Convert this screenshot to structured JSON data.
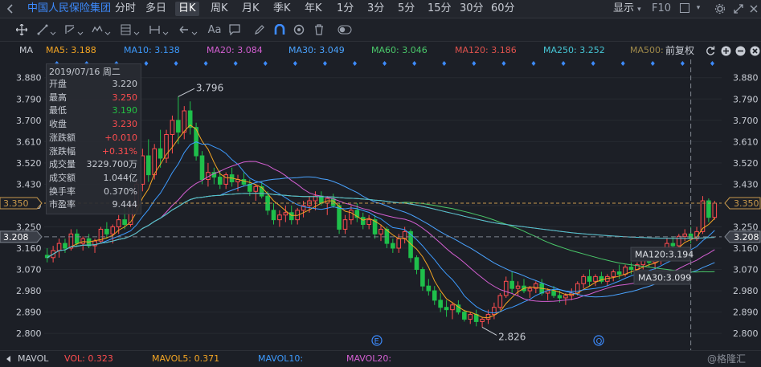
{
  "header": {
    "stock_name": "中国人民保险集团",
    "tabs": [
      "分时",
      "多日",
      "日K",
      "周K",
      "月K",
      "季K",
      "年K",
      "1分",
      "3分",
      "5分",
      "15分",
      "30分",
      "60分"
    ],
    "active_tab": "日K",
    "display_label": "显示",
    "f10_label": "F10"
  },
  "toolbar": {
    "font_label": "Aa"
  },
  "ma_bar": {
    "label": "MA",
    "items": [
      {
        "text": "MA5: 3.188",
        "color": "#f5a623"
      },
      {
        "text": "MA10: 3.138",
        "color": "#3d9bff"
      },
      {
        "text": "MA20: 3.084",
        "color": "#d45fd2"
      },
      {
        "text": "MA30: 3.049",
        "color": "#4aa3ff"
      },
      {
        "text": "MA60: 3.046",
        "color": "#4ac96a"
      },
      {
        "text": "MA120: 3.186",
        "color": "#e0524d"
      },
      {
        "text": "MA250: 3.252",
        "color": "#46c7d6"
      },
      {
        "text": "MA500:",
        "color": "#a08a4a"
      }
    ],
    "adjust_label": "前复权"
  },
  "info_panel": {
    "date": "2019/07/16 周二",
    "rows": [
      {
        "label": "开盘",
        "value": "3.220",
        "color": "#c8ccd4"
      },
      {
        "label": "最高",
        "value": "3.250",
        "color": "#ff4d4f"
      },
      {
        "label": "最低",
        "value": "3.190",
        "color": "#23c343"
      },
      {
        "label": "收盘",
        "value": "3.230",
        "color": "#ff4d4f"
      },
      {
        "label": "涨跌额",
        "value": "+0.010",
        "color": "#ff4d4f"
      },
      {
        "label": "涨跌幅",
        "value": "+0.31%",
        "color": "#ff4d4f"
      },
      {
        "label": "成交量",
        "value": "3229.700万",
        "color": "#c8ccd4"
      },
      {
        "label": "成交额",
        "value": "1.044亿",
        "color": "#c8ccd4"
      },
      {
        "label": "换手率",
        "value": "0.370%",
        "color": "#c8ccd4"
      },
      {
        "label": "市盈率",
        "value": "9.444",
        "color": "#c8ccd4"
      }
    ]
  },
  "axis": {
    "ticks": [
      "3.880",
      "3.790",
      "3.700",
      "3.610",
      "3.520",
      "3.430",
      "3.340",
      "3.250",
      "3.160",
      "3.070",
      "2.980",
      "2.890",
      "2.800"
    ],
    "current_price": "3.350",
    "cursor_price": "3.208"
  },
  "annotations": {
    "high": "3.796",
    "low": "2.826",
    "ma120_callout": "MA120:3.194",
    "ma30_callout": "MA30:3.099",
    "marker_e": "E",
    "marker_q": "Q"
  },
  "volume_bar": {
    "label": "MAVOL",
    "items": [
      {
        "text": "VOL: 0.323",
        "color": "#ff4d4f"
      },
      {
        "text": "MAVOL5: 0.371",
        "color": "#f5a623"
      },
      {
        "text": "MAVOL10:",
        "color": "#3d9bff"
      },
      {
        "text": "MAVOL20:",
        "color": "#d45fd2"
      }
    ],
    "watermark": "@格隆汇"
  },
  "chart_data": {
    "type": "candlestick",
    "ylim": [
      2.77,
      3.93
    ],
    "candles": [
      [
        3.13,
        3.16,
        3.1,
        3.12
      ],
      [
        3.12,
        3.17,
        3.1,
        3.15
      ],
      [
        3.15,
        3.2,
        3.12,
        3.18
      ],
      [
        3.18,
        3.2,
        3.14,
        3.16
      ],
      [
        3.16,
        3.24,
        3.15,
        3.22
      ],
      [
        3.22,
        3.24,
        3.17,
        3.18
      ],
      [
        3.18,
        3.21,
        3.15,
        3.2
      ],
      [
        3.2,
        3.22,
        3.16,
        3.17
      ],
      [
        3.17,
        3.2,
        3.14,
        3.19
      ],
      [
        3.19,
        3.25,
        3.18,
        3.24
      ],
      [
        3.24,
        3.27,
        3.2,
        3.22
      ],
      [
        3.22,
        3.26,
        3.18,
        3.25
      ],
      [
        3.25,
        3.3,
        3.22,
        3.28
      ],
      [
        3.28,
        3.33,
        3.24,
        3.26
      ],
      [
        3.26,
        3.36,
        3.25,
        3.34
      ],
      [
        3.34,
        3.45,
        3.32,
        3.43
      ],
      [
        3.43,
        3.58,
        3.4,
        3.55
      ],
      [
        3.55,
        3.62,
        3.44,
        3.47
      ],
      [
        3.47,
        3.6,
        3.45,
        3.58
      ],
      [
        3.58,
        3.66,
        3.5,
        3.54
      ],
      [
        3.54,
        3.66,
        3.52,
        3.64
      ],
      [
        3.64,
        3.72,
        3.56,
        3.7
      ],
      [
        3.7,
        3.8,
        3.6,
        3.65
      ],
      [
        3.65,
        3.76,
        3.62,
        3.74
      ],
      [
        3.74,
        3.78,
        3.64,
        3.67
      ],
      [
        3.67,
        3.69,
        3.53,
        3.55
      ],
      [
        3.55,
        3.57,
        3.43,
        3.45
      ],
      [
        3.45,
        3.52,
        3.42,
        3.48
      ],
      [
        3.48,
        3.5,
        3.43,
        3.46
      ],
      [
        3.46,
        3.49,
        3.41,
        3.43
      ],
      [
        3.43,
        3.48,
        3.41,
        3.47
      ],
      [
        3.47,
        3.5,
        3.42,
        3.44
      ],
      [
        3.44,
        3.47,
        3.4,
        3.45
      ],
      [
        3.45,
        3.48,
        3.42,
        3.43
      ],
      [
        3.43,
        3.45,
        3.38,
        3.4
      ],
      [
        3.4,
        3.43,
        3.36,
        3.42
      ],
      [
        3.42,
        3.44,
        3.37,
        3.38
      ],
      [
        3.38,
        3.4,
        3.3,
        3.32
      ],
      [
        3.32,
        3.35,
        3.26,
        3.28
      ],
      [
        3.28,
        3.32,
        3.25,
        3.3
      ],
      [
        3.3,
        3.34,
        3.27,
        3.31
      ],
      [
        3.31,
        3.34,
        3.26,
        3.28
      ],
      [
        3.28,
        3.33,
        3.26,
        3.32
      ],
      [
        3.32,
        3.36,
        3.29,
        3.34
      ],
      [
        3.34,
        3.38,
        3.31,
        3.36
      ],
      [
        3.36,
        3.4,
        3.32,
        3.38
      ],
      [
        3.38,
        3.4,
        3.34,
        3.35
      ],
      [
        3.35,
        3.38,
        3.3,
        3.37
      ],
      [
        3.37,
        3.39,
        3.33,
        3.34
      ],
      [
        3.34,
        3.35,
        3.22,
        3.24
      ],
      [
        3.24,
        3.3,
        3.22,
        3.28
      ],
      [
        3.28,
        3.34,
        3.26,
        3.32
      ],
      [
        3.32,
        3.35,
        3.27,
        3.29
      ],
      [
        3.29,
        3.31,
        3.24,
        3.26
      ],
      [
        3.26,
        3.3,
        3.24,
        3.28
      ],
      [
        3.28,
        3.3,
        3.2,
        3.22
      ],
      [
        3.22,
        3.26,
        3.19,
        3.24
      ],
      [
        3.24,
        3.25,
        3.16,
        3.18
      ],
      [
        3.18,
        3.2,
        3.14,
        3.16
      ],
      [
        3.16,
        3.22,
        3.14,
        3.2
      ],
      [
        3.2,
        3.25,
        3.18,
        3.23
      ],
      [
        3.23,
        3.24,
        3.1,
        3.12
      ],
      [
        3.12,
        3.13,
        3.05,
        3.07
      ],
      [
        3.07,
        3.08,
        2.98,
        3.0
      ],
      [
        3.0,
        3.03,
        2.96,
        2.98
      ],
      [
        2.98,
        3.0,
        2.92,
        2.94
      ],
      [
        2.94,
        2.97,
        2.89,
        2.91
      ],
      [
        2.91,
        2.94,
        2.87,
        2.9
      ],
      [
        2.9,
        2.93,
        2.86,
        2.92
      ],
      [
        2.92,
        2.94,
        2.88,
        2.89
      ],
      [
        2.89,
        2.9,
        2.85,
        2.86
      ],
      [
        2.86,
        2.89,
        2.84,
        2.88
      ],
      [
        2.88,
        2.9,
        2.83,
        2.85
      ],
      [
        2.85,
        2.87,
        2.826,
        2.86
      ],
      [
        2.86,
        2.9,
        2.84,
        2.88
      ],
      [
        2.88,
        2.93,
        2.86,
        2.91
      ],
      [
        2.91,
        2.97,
        2.9,
        2.96
      ],
      [
        2.96,
        3.04,
        2.95,
        3.02
      ],
      [
        3.02,
        3.06,
        2.97,
        2.99
      ],
      [
        2.99,
        3.02,
        2.96,
        3.0
      ],
      [
        3.0,
        3.03,
        2.97,
        2.98
      ],
      [
        2.98,
        3.0,
        2.95,
        2.99
      ],
      [
        2.99,
        3.02,
        2.97,
        3.01
      ],
      [
        3.01,
        3.03,
        2.96,
        2.97
      ],
      [
        2.97,
        2.99,
        2.94,
        2.98
      ],
      [
        2.98,
        3.0,
        2.95,
        2.96
      ],
      [
        2.96,
        2.98,
        2.93,
        2.95
      ],
      [
        2.95,
        2.97,
        2.92,
        2.96
      ],
      [
        2.96,
        2.99,
        2.94,
        2.97
      ],
      [
        2.97,
        3.02,
        2.96,
        3.01
      ],
      [
        3.01,
        3.05,
        2.99,
        3.04
      ],
      [
        3.04,
        3.07,
        3.0,
        3.02
      ],
      [
        3.02,
        3.05,
        3.0,
        3.04
      ],
      [
        3.04,
        3.06,
        3.01,
        3.02
      ],
      [
        3.02,
        3.05,
        3.0,
        3.04
      ],
      [
        3.04,
        3.07,
        3.02,
        3.06
      ],
      [
        3.06,
        3.09,
        3.03,
        3.05
      ],
      [
        3.05,
        3.09,
        3.04,
        3.08
      ],
      [
        3.08,
        3.1,
        3.05,
        3.07
      ],
      [
        3.07,
        3.1,
        3.05,
        3.09
      ],
      [
        3.09,
        3.13,
        3.07,
        3.11
      ],
      [
        3.11,
        3.13,
        3.08,
        3.1
      ],
      [
        3.1,
        3.12,
        3.07,
        3.11
      ],
      [
        3.11,
        3.15,
        3.09,
        3.14
      ],
      [
        3.14,
        3.2,
        3.13,
        3.18
      ],
      [
        3.18,
        3.21,
        3.15,
        3.17
      ],
      [
        3.17,
        3.22,
        3.16,
        3.21
      ],
      [
        3.21,
        3.24,
        3.19,
        3.22
      ],
      [
        3.22,
        3.25,
        3.18,
        3.2
      ],
      [
        3.2,
        3.25,
        3.19,
        3.23
      ],
      [
        3.23,
        3.38,
        3.22,
        3.36
      ],
      [
        3.36,
        3.37,
        3.27,
        3.29
      ],
      [
        3.29,
        3.36,
        3.28,
        3.35
      ]
    ],
    "last_price": 3.35,
    "high_label": "3.796",
    "low_label": "2.826"
  }
}
